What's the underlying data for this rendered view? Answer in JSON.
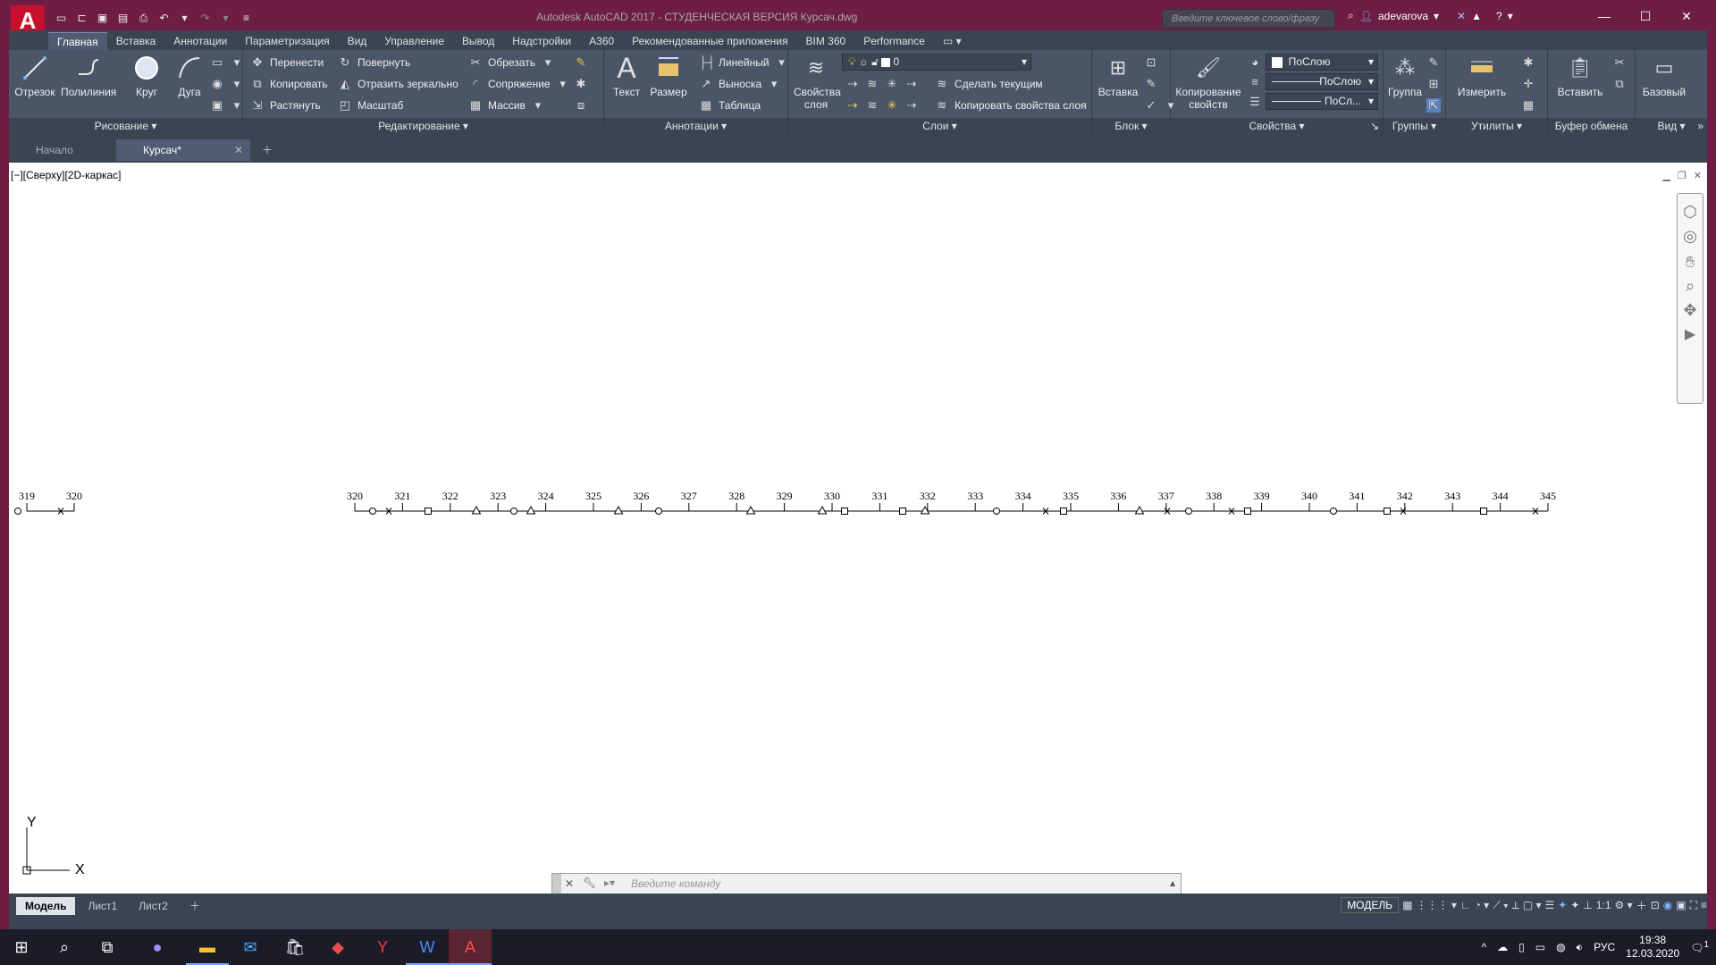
{
  "titlebar": {
    "logo": "A",
    "title": "Autodesk AutoCAD 2017 - СТУДЕНЧЕСКАЯ ВЕРСИЯ    Курсач.dwg",
    "search_placeholder": "Введите ключевое слово/фразу",
    "username": "adevarova"
  },
  "menu": {
    "tabs": [
      "Главная",
      "Вставка",
      "Аннотации",
      "Параметризация",
      "Вид",
      "Управление",
      "Вывод",
      "Надстройки",
      "A360",
      "Рекомендованные приложения",
      "BIM 360",
      "Performance"
    ]
  },
  "ribbon": {
    "draw": {
      "title": "Рисование",
      "line": "Отрезок",
      "polyline": "Полилиния",
      "circle": "Круг",
      "arc": "Дуга"
    },
    "modify": {
      "title": "Редактирование",
      "move": "Перенести",
      "rotate": "Повернуть",
      "trim": "Обрезать",
      "copy": "Копировать",
      "mirror": "Отразить зеркально",
      "fillet": "Сопряжение",
      "stretch": "Растянуть",
      "scale": "Масштаб",
      "array": "Массив"
    },
    "annotation": {
      "title": "Аннотации",
      "text": "Текст",
      "dimension": "Размер",
      "linear": "Линейный",
      "leader": "Выноска",
      "table": "Таблица"
    },
    "layers": {
      "title": "Слои",
      "properties": "Свойства слоя",
      "properties_line2": "слоя",
      "properties_line1": "Свойства",
      "current_layer": "0",
      "make_current": "Сделать текущим",
      "match_layer": "Копировать свойства слоя"
    },
    "block": {
      "title": "Блок",
      "insert": "Вставка"
    },
    "properties": {
      "title": "Свойства",
      "match": "Копирование",
      "match2": "свойств",
      "color": "ПоСлою",
      "linetype": "ПоСлою",
      "lineweight": "ПоСл..."
    },
    "groups": {
      "title": "Группы",
      "group": "Группа"
    },
    "utilities": {
      "title": "Утилиты",
      "measure": "Измерить"
    },
    "clipboard": {
      "title": "Буфер обмена",
      "paste": "Вставить"
    },
    "view": {
      "title": "Вид",
      "base": "Базовый"
    }
  },
  "filetabs": {
    "start": "Начало",
    "current": "Курсач*"
  },
  "viewport": {
    "label": "[−][Сверху][2D-каркас]"
  },
  "ucs": {
    "y": "Y",
    "x": "X"
  },
  "stations_left": [
    "319",
    "320"
  ],
  "stations_right": [
    "320",
    "321",
    "322",
    "323",
    "324",
    "325",
    "326",
    "327",
    "328",
    "329",
    "330",
    "331",
    "332",
    "333",
    "334",
    "335",
    "336",
    "337",
    "338",
    "339",
    "340",
    "341",
    "342",
    "343",
    "344",
    "345"
  ],
  "command": {
    "placeholder": "Введите команду"
  },
  "layouts": {
    "tabs": [
      "Модель",
      "Лист1",
      "Лист2"
    ]
  },
  "status": {
    "model": "МОДЕЛЬ",
    "scale": "1:1"
  },
  "tray": {
    "lang": "РУС",
    "time": "19:38",
    "date": "12.03.2020",
    "notif": "1"
  }
}
